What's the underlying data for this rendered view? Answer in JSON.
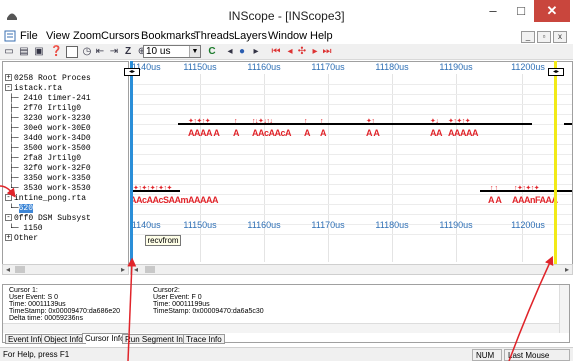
{
  "window": {
    "title": "INScope - [INScope3]",
    "minimize": "–",
    "maximize": "□",
    "close": "✕"
  },
  "menu": [
    "File",
    "View",
    "Zoom",
    "Cursors",
    "Bookmarks",
    "Threads",
    "Layers",
    "Window",
    "Help"
  ],
  "mdi": {
    "minimize": "_",
    "restore": "▫",
    "close": "x"
  },
  "toolbar": {
    "zoom_value": "10 us"
  },
  "tree": {
    "items": [
      {
        "box": "+",
        "text": "0258 Root Proces"
      },
      {
        "box": "-",
        "text": "istack.rta"
      },
      {
        "text": "2410 timer-241"
      },
      {
        "text": "2f70 Irtilg0"
      },
      {
        "text": "3230 work-3230"
      },
      {
        "text": "30e0 work-30E0"
      },
      {
        "text": "34d0 work-34D0"
      },
      {
        "text": "3500 work-3500"
      },
      {
        "text": "2fa8 Jrtilg0"
      },
      {
        "text": "32f0 work-32F0"
      },
      {
        "text": "3350 work-3350"
      },
      {
        "text": "3530 work-3530"
      },
      {
        "box": "-",
        "text": "intine_pong.rta"
      },
      {
        "text": "620",
        "selected": true
      },
      {
        "box": "-",
        "text": "0ff0 DSM Subsyst"
      },
      {
        "text": "1150"
      },
      {
        "box": "+",
        "text": "Other"
      }
    ]
  },
  "timeline": {
    "ticks": [
      "11140us",
      "11150us",
      "11160us",
      "11170us",
      "11180us",
      "11190us",
      "11200us"
    ],
    "events_row1": {
      "g1": "AAAA A",
      "g2": "A",
      "g3": "AAcAAcA",
      "g4": "A",
      "g5": "A",
      "g6": "A A",
      "g7": "AA",
      "g8": "AAAAA"
    },
    "events_row2": {
      "g1": "AAcAAcSAAmAAAAA",
      "g2": "A A",
      "g3": "AAAnFAAA"
    },
    "tooltip": "recvfrom"
  },
  "info": {
    "cursor1": [
      "Cursor 1:",
      "User Event: S  0",
      "Time: 00011139us",
      "TimeStamp: 0x00009470:da686e20",
      "Delta time: 00059236ns"
    ],
    "cursor2": [
      "Cursor2:",
      "User Event: F  0",
      "Time: 00011199us",
      "TimeStamp: 0x00009470:da6a5c30"
    ]
  },
  "tabs": [
    "Event Info",
    "Object Info",
    "Cursor Info",
    "Run Segment Info",
    "Trace Info"
  ],
  "status": {
    "help": "For Help, press F1",
    "num": "NUM",
    "mouse": "Last Mouse"
  }
}
